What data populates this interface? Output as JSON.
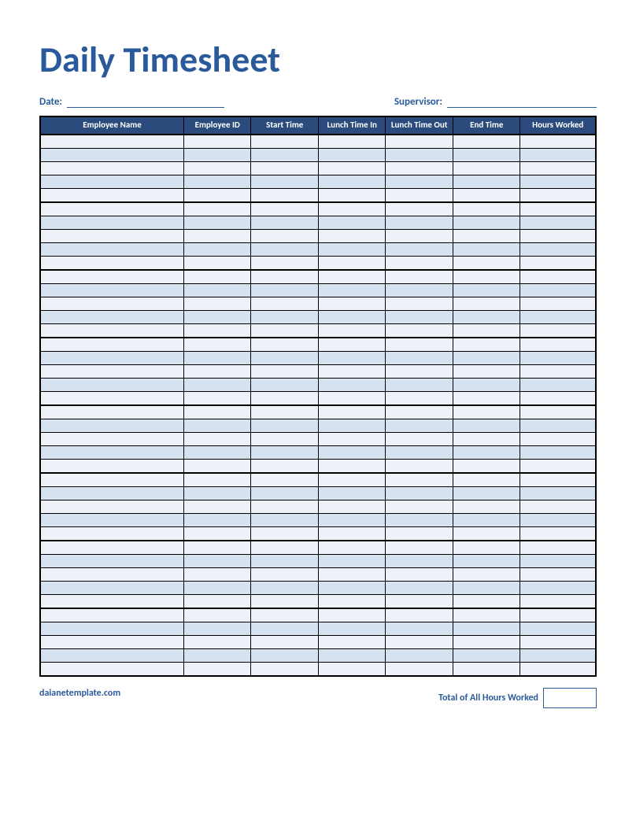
{
  "title": "Daily Timesheet",
  "meta": {
    "date_label": "Date:",
    "date_value": "",
    "supervisor_label": "Supervisor:",
    "supervisor_value": ""
  },
  "columns": [
    "Employee Name",
    "Employee ID",
    "Start Time",
    "Lunch Time In",
    "Lunch Time Out",
    "End Time",
    "Hours Worked"
  ],
  "groups": 8,
  "rows_per_group": 5,
  "footer": {
    "website": "daianetemplate.com",
    "total_label": "Total of All Hours Worked",
    "total_value": ""
  },
  "colors": {
    "brand": "#2a5a9b",
    "header_bg": "#2a4b7c",
    "row_light": "#eef2f8",
    "row_blue": "#d7e2f0"
  }
}
